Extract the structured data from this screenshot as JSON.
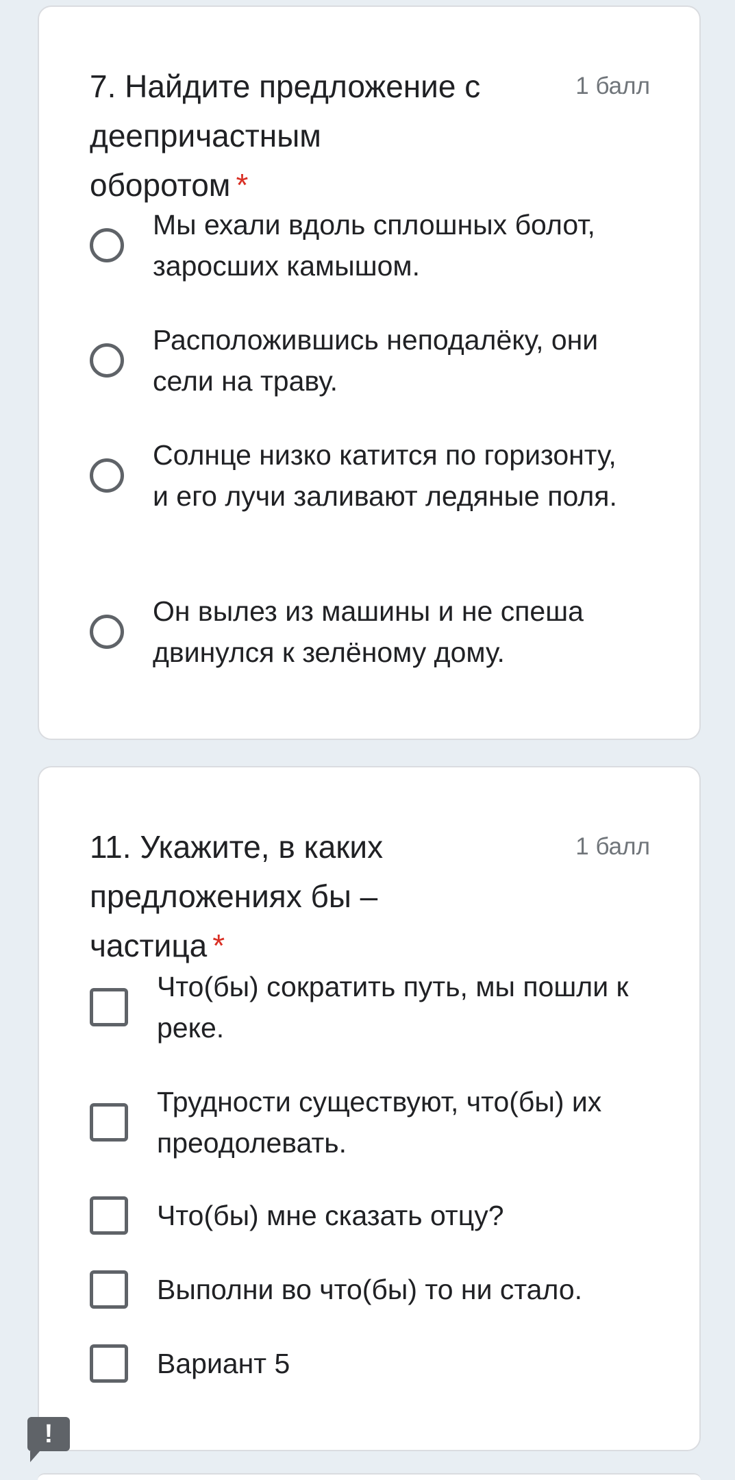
{
  "questions": [
    {
      "title": "7. Найдите предложение с деепричастным оборотом",
      "required_mark": "*",
      "points": "1 балл",
      "type": "radio",
      "options": [
        "Мы ехали вдоль сплошных болот, заросших камышом.",
        "Расположившись неподалёку, они сели на траву.",
        "Солнце низко катится по горизонту, и его лучи заливают ледяные поля.",
        "Он вылез из машины и не спеша двинулся к зелёному дому."
      ]
    },
    {
      "title": "11. Укажите, в каких предложениях бы – частица",
      "required_mark": "*",
      "points": "1 балл",
      "type": "checkbox",
      "options": [
        "Что(бы) сократить путь, мы пошли к реке.",
        "Трудности существуют, что(бы) их преодолевать.",
        "Что(бы) мне сказать отцу?",
        "Выполни во что(бы) то ни стало.",
        "Вариант 5"
      ]
    }
  ],
  "feedback": {
    "icon": "report-feedback-icon",
    "glyph": "!"
  },
  "colors": {
    "background": "#e8eef3",
    "card": "#ffffff",
    "required": "#d93025",
    "control": "#5f6368"
  }
}
